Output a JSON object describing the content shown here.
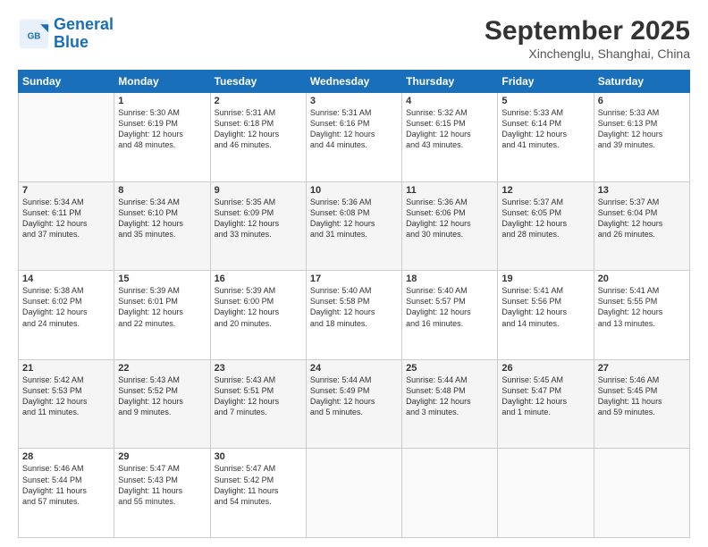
{
  "header": {
    "logo_line1": "General",
    "logo_line2": "Blue",
    "month": "September 2025",
    "location": "Xinchenglu, Shanghai, China"
  },
  "weekdays": [
    "Sunday",
    "Monday",
    "Tuesday",
    "Wednesday",
    "Thursday",
    "Friday",
    "Saturday"
  ],
  "weeks": [
    [
      {
        "num": "",
        "info": ""
      },
      {
        "num": "1",
        "info": "Sunrise: 5:30 AM\nSunset: 6:19 PM\nDaylight: 12 hours\nand 48 minutes."
      },
      {
        "num": "2",
        "info": "Sunrise: 5:31 AM\nSunset: 6:18 PM\nDaylight: 12 hours\nand 46 minutes."
      },
      {
        "num": "3",
        "info": "Sunrise: 5:31 AM\nSunset: 6:16 PM\nDaylight: 12 hours\nand 44 minutes."
      },
      {
        "num": "4",
        "info": "Sunrise: 5:32 AM\nSunset: 6:15 PM\nDaylight: 12 hours\nand 43 minutes."
      },
      {
        "num": "5",
        "info": "Sunrise: 5:33 AM\nSunset: 6:14 PM\nDaylight: 12 hours\nand 41 minutes."
      },
      {
        "num": "6",
        "info": "Sunrise: 5:33 AM\nSunset: 6:13 PM\nDaylight: 12 hours\nand 39 minutes."
      }
    ],
    [
      {
        "num": "7",
        "info": "Sunrise: 5:34 AM\nSunset: 6:11 PM\nDaylight: 12 hours\nand 37 minutes."
      },
      {
        "num": "8",
        "info": "Sunrise: 5:34 AM\nSunset: 6:10 PM\nDaylight: 12 hours\nand 35 minutes."
      },
      {
        "num": "9",
        "info": "Sunrise: 5:35 AM\nSunset: 6:09 PM\nDaylight: 12 hours\nand 33 minutes."
      },
      {
        "num": "10",
        "info": "Sunrise: 5:36 AM\nSunset: 6:08 PM\nDaylight: 12 hours\nand 31 minutes."
      },
      {
        "num": "11",
        "info": "Sunrise: 5:36 AM\nSunset: 6:06 PM\nDaylight: 12 hours\nand 30 minutes."
      },
      {
        "num": "12",
        "info": "Sunrise: 5:37 AM\nSunset: 6:05 PM\nDaylight: 12 hours\nand 28 minutes."
      },
      {
        "num": "13",
        "info": "Sunrise: 5:37 AM\nSunset: 6:04 PM\nDaylight: 12 hours\nand 26 minutes."
      }
    ],
    [
      {
        "num": "14",
        "info": "Sunrise: 5:38 AM\nSunset: 6:02 PM\nDaylight: 12 hours\nand 24 minutes."
      },
      {
        "num": "15",
        "info": "Sunrise: 5:39 AM\nSunset: 6:01 PM\nDaylight: 12 hours\nand 22 minutes."
      },
      {
        "num": "16",
        "info": "Sunrise: 5:39 AM\nSunset: 6:00 PM\nDaylight: 12 hours\nand 20 minutes."
      },
      {
        "num": "17",
        "info": "Sunrise: 5:40 AM\nSunset: 5:58 PM\nDaylight: 12 hours\nand 18 minutes."
      },
      {
        "num": "18",
        "info": "Sunrise: 5:40 AM\nSunset: 5:57 PM\nDaylight: 12 hours\nand 16 minutes."
      },
      {
        "num": "19",
        "info": "Sunrise: 5:41 AM\nSunset: 5:56 PM\nDaylight: 12 hours\nand 14 minutes."
      },
      {
        "num": "20",
        "info": "Sunrise: 5:41 AM\nSunset: 5:55 PM\nDaylight: 12 hours\nand 13 minutes."
      }
    ],
    [
      {
        "num": "21",
        "info": "Sunrise: 5:42 AM\nSunset: 5:53 PM\nDaylight: 12 hours\nand 11 minutes."
      },
      {
        "num": "22",
        "info": "Sunrise: 5:43 AM\nSunset: 5:52 PM\nDaylight: 12 hours\nand 9 minutes."
      },
      {
        "num": "23",
        "info": "Sunrise: 5:43 AM\nSunset: 5:51 PM\nDaylight: 12 hours\nand 7 minutes."
      },
      {
        "num": "24",
        "info": "Sunrise: 5:44 AM\nSunset: 5:49 PM\nDaylight: 12 hours\nand 5 minutes."
      },
      {
        "num": "25",
        "info": "Sunrise: 5:44 AM\nSunset: 5:48 PM\nDaylight: 12 hours\nand 3 minutes."
      },
      {
        "num": "26",
        "info": "Sunrise: 5:45 AM\nSunset: 5:47 PM\nDaylight: 12 hours\nand 1 minute."
      },
      {
        "num": "27",
        "info": "Sunrise: 5:46 AM\nSunset: 5:45 PM\nDaylight: 11 hours\nand 59 minutes."
      }
    ],
    [
      {
        "num": "28",
        "info": "Sunrise: 5:46 AM\nSunset: 5:44 PM\nDaylight: 11 hours\nand 57 minutes."
      },
      {
        "num": "29",
        "info": "Sunrise: 5:47 AM\nSunset: 5:43 PM\nDaylight: 11 hours\nand 55 minutes."
      },
      {
        "num": "30",
        "info": "Sunrise: 5:47 AM\nSunset: 5:42 PM\nDaylight: 11 hours\nand 54 minutes."
      },
      {
        "num": "",
        "info": ""
      },
      {
        "num": "",
        "info": ""
      },
      {
        "num": "",
        "info": ""
      },
      {
        "num": "",
        "info": ""
      }
    ]
  ]
}
